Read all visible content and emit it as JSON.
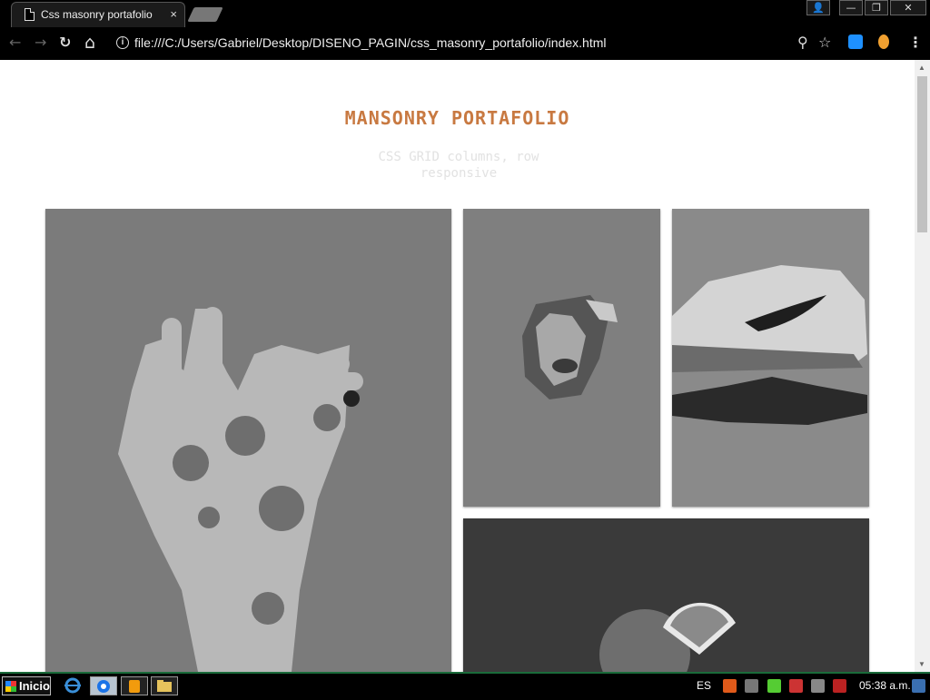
{
  "browser": {
    "tab": {
      "title": "Css masonry portafolio",
      "close": "×"
    },
    "window": {
      "minimize": "—",
      "restore": "❐",
      "close": "✕",
      "profile": "👤"
    },
    "toolbar": {
      "back": "←",
      "forward": "→",
      "reload": "↻",
      "home": "⌂",
      "info": "i",
      "url": "file:///C:/Users/Gabriel/Desktop/DISENO_PAGIN/css_masonry_portafolio/index.html",
      "zoom": "⚲",
      "star": "☆",
      "menu": "⋮"
    }
  },
  "page": {
    "title": "MANSONRY PORTAFOLIO",
    "subtitle": "CSS GRID columns, row responsive",
    "gallery": [
      {
        "name": "hands-glitter-photo",
        "icon": "hands-photo"
      },
      {
        "name": "face-torn-paper-photo",
        "icon": "face-photo"
      },
      {
        "name": "sneaker-photo",
        "icon": "sneaker-photo"
      },
      {
        "name": "orange-fruit-photo",
        "icon": "orange-photo"
      }
    ]
  },
  "taskbar": {
    "start_label": "Inicio",
    "language": "ES",
    "clock": "05:38 a.m."
  }
}
